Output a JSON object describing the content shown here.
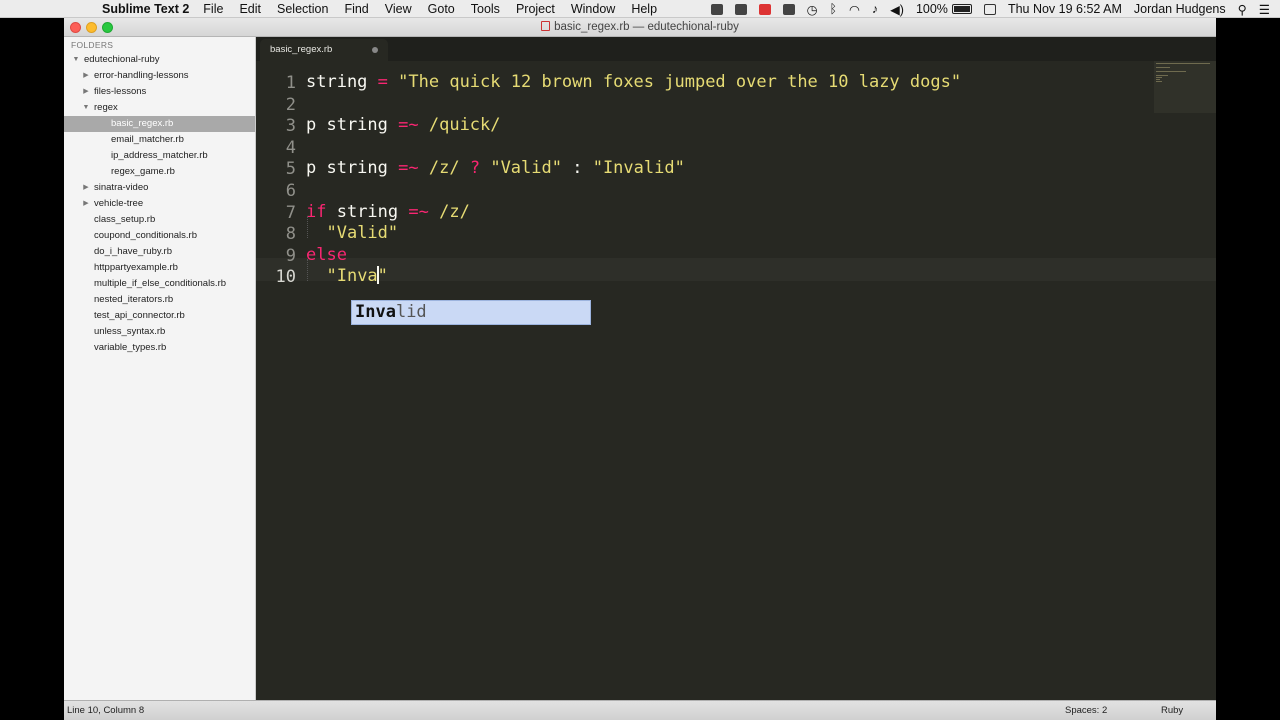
{
  "menubar": {
    "app_name": "Sublime Text 2",
    "items": [
      "File",
      "Edit",
      "Selection",
      "Find",
      "View",
      "Goto",
      "Tools",
      "Project",
      "Window",
      "Help"
    ],
    "battery": "100%",
    "clock": "Thu Nov 19  6:52 AM",
    "user": "Jordan Hudgens"
  },
  "window": {
    "title": "basic_regex.rb — edutechional-ruby"
  },
  "sidebar": {
    "header": "FOLDERS",
    "items": [
      {
        "label": "edutechional-ruby",
        "depth": 0,
        "arrow": "open"
      },
      {
        "label": "error-handling-lessons",
        "depth": 1,
        "arrow": "closed"
      },
      {
        "label": "files-lessons",
        "depth": 1,
        "arrow": "closed"
      },
      {
        "label": "regex",
        "depth": 1,
        "arrow": "open"
      },
      {
        "label": "basic_regex.rb",
        "depth": 2,
        "arrow": "",
        "selected": true
      },
      {
        "label": "email_matcher.rb",
        "depth": 2,
        "arrow": ""
      },
      {
        "label": "ip_address_matcher.rb",
        "depth": 2,
        "arrow": ""
      },
      {
        "label": "regex_game.rb",
        "depth": 2,
        "arrow": ""
      },
      {
        "label": "sinatra-video",
        "depth": 1,
        "arrow": "closed"
      },
      {
        "label": "vehicle-tree",
        "depth": 1,
        "arrow": "closed"
      },
      {
        "label": "class_setup.rb",
        "depth": 1,
        "arrow": ""
      },
      {
        "label": "coupond_conditionals.rb",
        "depth": 1,
        "arrow": ""
      },
      {
        "label": "do_i_have_ruby.rb",
        "depth": 1,
        "arrow": ""
      },
      {
        "label": "httppartyexample.rb",
        "depth": 1,
        "arrow": ""
      },
      {
        "label": "multiple_if_else_conditionals.rb",
        "depth": 1,
        "arrow": ""
      },
      {
        "label": "nested_iterators.rb",
        "depth": 1,
        "arrow": ""
      },
      {
        "label": "test_api_connector.rb",
        "depth": 1,
        "arrow": ""
      },
      {
        "label": "unless_syntax.rb",
        "depth": 1,
        "arrow": ""
      },
      {
        "label": "variable_types.rb",
        "depth": 1,
        "arrow": ""
      }
    ]
  },
  "tab": {
    "label": "basic_regex.rb"
  },
  "editor": {
    "active_line": 10,
    "lines": [
      {
        "num": "1",
        "tokens": [
          {
            "t": "string ",
            "c": "plain"
          },
          {
            "t": "=",
            "c": "op"
          },
          {
            "t": " ",
            "c": "plain"
          },
          {
            "t": "\"The quick 12 brown foxes jumped over the 10 lazy dogs\"",
            "c": "str"
          }
        ]
      },
      {
        "num": "2",
        "tokens": []
      },
      {
        "num": "3",
        "tokens": [
          {
            "t": "p string ",
            "c": "plain"
          },
          {
            "t": "=~",
            "c": "op"
          },
          {
            "t": " ",
            "c": "plain"
          },
          {
            "t": "/quick/",
            "c": "str"
          }
        ]
      },
      {
        "num": "4",
        "tokens": []
      },
      {
        "num": "5",
        "tokens": [
          {
            "t": "p string ",
            "c": "plain"
          },
          {
            "t": "=~",
            "c": "op"
          },
          {
            "t": " ",
            "c": "plain"
          },
          {
            "t": "/z/",
            "c": "str"
          },
          {
            "t": " ",
            "c": "plain"
          },
          {
            "t": "?",
            "c": "op"
          },
          {
            "t": " ",
            "c": "plain"
          },
          {
            "t": "\"Valid\"",
            "c": "str"
          },
          {
            "t": " : ",
            "c": "plain"
          },
          {
            "t": "\"Invalid\"",
            "c": "str"
          }
        ]
      },
      {
        "num": "6",
        "tokens": []
      },
      {
        "num": "7",
        "tokens": [
          {
            "t": "if",
            "c": "kw"
          },
          {
            "t": " string ",
            "c": "plain"
          },
          {
            "t": "=~",
            "c": "op"
          },
          {
            "t": " ",
            "c": "plain"
          },
          {
            "t": "/z/",
            "c": "str"
          }
        ]
      },
      {
        "num": "8",
        "tokens": [
          {
            "t": "  ",
            "c": "plain"
          },
          {
            "t": "\"Valid\"",
            "c": "str"
          }
        ]
      },
      {
        "num": "9",
        "tokens": [
          {
            "t": "else",
            "c": "kw"
          }
        ]
      },
      {
        "num": "10",
        "tokens": [
          {
            "t": "  ",
            "c": "plain"
          },
          {
            "t": "\"Inva",
            "c": "str"
          },
          {
            "t": "|",
            "c": "cursor"
          },
          {
            "t": "\"",
            "c": "str"
          }
        ]
      }
    ],
    "autocomplete": {
      "typed": "Inva",
      "rest": "lid"
    }
  },
  "statusbar": {
    "position": "Line 10, Column 8",
    "spaces": "Spaces: 2",
    "syntax": "Ruby"
  },
  "colors": {
    "editor_bg": "#272822",
    "keyword": "#f92672",
    "string": "#e6db74",
    "text": "#f8f8f2",
    "autocomplete_bg": "#cad9f5"
  }
}
